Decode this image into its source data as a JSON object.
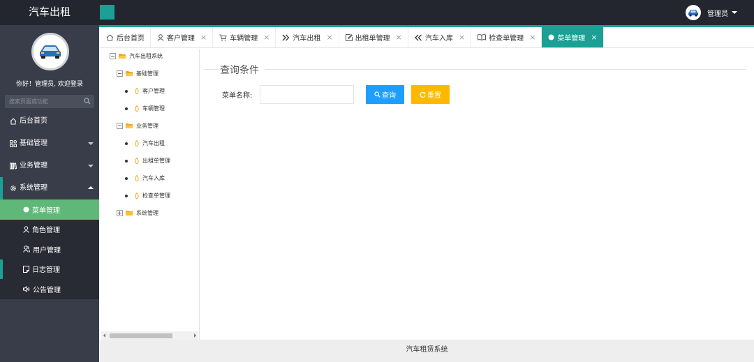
{
  "header": {
    "logo_text": "汽车出租",
    "user_name": "管理员",
    "accent_color": "#1aa094"
  },
  "sidebar": {
    "welcome_text": "你好！管理员, 欢迎登录",
    "search_placeholder": "搜索页面或功能",
    "items": [
      {
        "label": "后台首页",
        "icon": "home-icon"
      },
      {
        "label": "基础管理",
        "icon": "grid-icon"
      },
      {
        "label": "业务管理",
        "icon": "book-icon"
      },
      {
        "label": "系统管理",
        "icon": "gear-icon"
      }
    ],
    "submenu": [
      {
        "label": "菜单管理",
        "icon": "dot-icon",
        "active": true
      },
      {
        "label": "角色管理",
        "icon": "user-icon"
      },
      {
        "label": "用户管理",
        "icon": "users-icon"
      },
      {
        "label": "日志管理",
        "icon": "note-icon"
      },
      {
        "label": "公告管理",
        "icon": "speaker-icon"
      }
    ]
  },
  "tabs": [
    {
      "label": "后台首页",
      "icon": "home-icon"
    },
    {
      "label": "客户管理",
      "icon": "user-icon"
    },
    {
      "label": "车辆管理",
      "icon": "cart-icon"
    },
    {
      "label": "汽车出租",
      "icon": "double-right-icon"
    },
    {
      "label": "出租单管理",
      "icon": "edit-icon"
    },
    {
      "label": "汽车入库",
      "icon": "double-left-icon"
    },
    {
      "label": "检查单管理",
      "icon": "open-book-icon"
    },
    {
      "label": "菜单管理",
      "icon": "dot-icon",
      "active": true
    }
  ],
  "tab_close_glyph": "×",
  "tree": {
    "root": "汽车出租系统",
    "basic": "基础管理",
    "basic_children": [
      "客户管理",
      "车辆管理"
    ],
    "business": "业务管理",
    "business_children": [
      "汽车出租",
      "出租单管理",
      "汽车入库",
      "检查单管理"
    ],
    "system": "系统管理"
  },
  "query": {
    "legend": "查询条件",
    "menu_name_label": "菜单名称:",
    "menu_name_value": "",
    "query_button": "查询",
    "reset_button": "重置"
  },
  "footer": {
    "text": "汽车租赁系统"
  }
}
